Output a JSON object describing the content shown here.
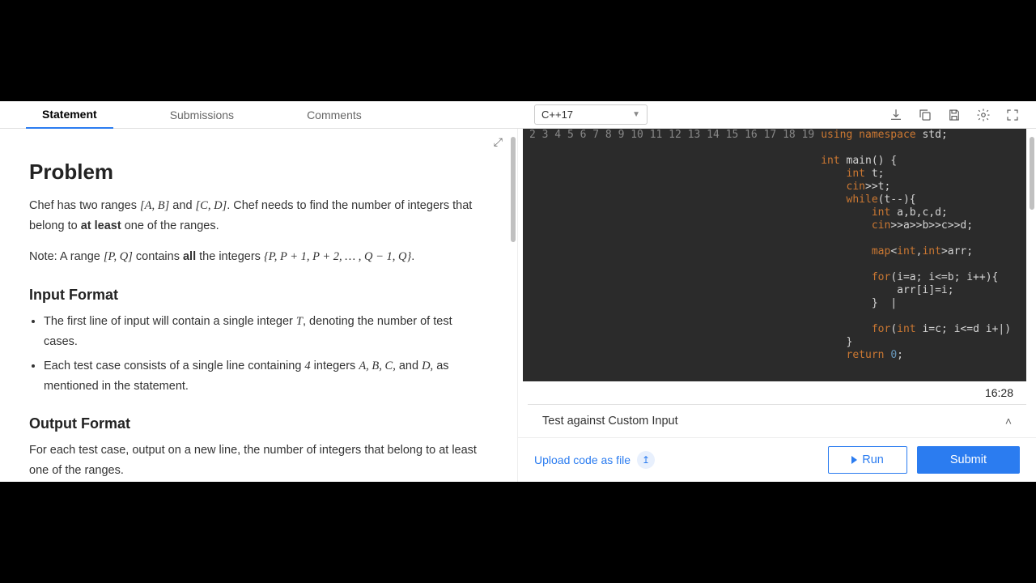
{
  "tabs": {
    "statement": "Statement",
    "submissions": "Submissions",
    "comments": "Comments"
  },
  "language": "C++17",
  "problem": {
    "title": "Problem",
    "body_pre": "Chef has two ranges ",
    "range1": "[A, B]",
    "body_mid1": " and ",
    "range2": "[C, D]",
    "body_mid2": ". Chef needs to find the number of integers that belong to ",
    "at_least": "at least",
    "body_post": " one of the ranges.",
    "note_pre": "Note: A range ",
    "note_range": "[P, Q]",
    "note_mid": " contains ",
    "all": "all",
    "note_mid2": " the integers ",
    "note_set": "{P, P + 1, P + 2, … , Q − 1, Q}",
    "note_end": "."
  },
  "input_format": {
    "heading": "Input Format",
    "li1_pre": "The first line of input will contain a single integer ",
    "li1_T": "T",
    "li1_post": ", denoting the number of test cases.",
    "li2_pre": "Each test case consists of a single line containing ",
    "li2_four": "4",
    "li2_mid": " integers ",
    "li2_vars": "A, B, C,",
    "li2_and": " and ",
    "li2_D": "D,",
    "li2_post": " as mentioned in the statement."
  },
  "output_format": {
    "heading": "Output Format",
    "body": "For each test case, output on a new line, the number of integers that belong to at least one of the ranges."
  },
  "code_lines": [
    "using namespace std;",
    "",
    "int main() {",
    "    int t;",
    "    cin>>t;",
    "    while(t--){",
    "        int a,b,c,d;",
    "        cin>>a>>b>>c>>d;",
    "        ",
    "        map<int,int>arr;",
    "        ",
    "        for(i=a; i<=b; i++){",
    "            arr[i]=i;",
    "        }  |",
    "        ",
    "        for(int i=c; i<=d i+|)",
    "    }",
    "    return 0;"
  ],
  "line_start": 2,
  "timer": "16:28",
  "custom_input": "Test against Custom Input",
  "upload": "Upload code as file",
  "run": "Run",
  "submit": "Submit"
}
